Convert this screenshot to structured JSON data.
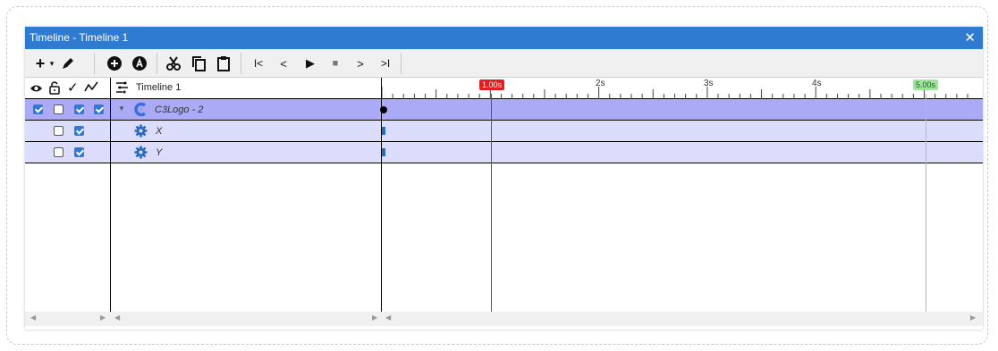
{
  "window": {
    "title": "Timeline - Timeline 1",
    "close_glyph": "✕"
  },
  "toolbar": {
    "add_glyph": "+",
    "add_dropdown_glyph": "▾",
    "first_glyph": "I<",
    "prev_glyph": "<",
    "play_glyph": "▶",
    "stop_glyph": "■",
    "next_glyph": ">",
    "last_glyph": ">I"
  },
  "header": {
    "timeline_name": "Timeline 1",
    "check_glyph": "✓",
    "graph_glyph": "〰"
  },
  "ruler": {
    "ticks": [
      "2s",
      "3s",
      "4s"
    ],
    "playhead_label": "1.00s",
    "end_label": "5.00s",
    "playhead_color": "#e02020",
    "end_color": "#7bd47b"
  },
  "tracks": [
    {
      "name": "C3Logo - 2",
      "visible": true,
      "locked": false,
      "enabled": true,
      "graph": true
    },
    {
      "name": "X",
      "locked": false,
      "enabled": true
    },
    {
      "name": "Y",
      "locked": false,
      "enabled": true
    }
  ],
  "colors": {
    "titlebar": "#2e7bd1",
    "selected_row": "#aaaaf7",
    "sub_row": "#dcdcfc",
    "checkbox": "#2d7bd6"
  },
  "scroll": {
    "left": "◀",
    "right": "▶"
  }
}
